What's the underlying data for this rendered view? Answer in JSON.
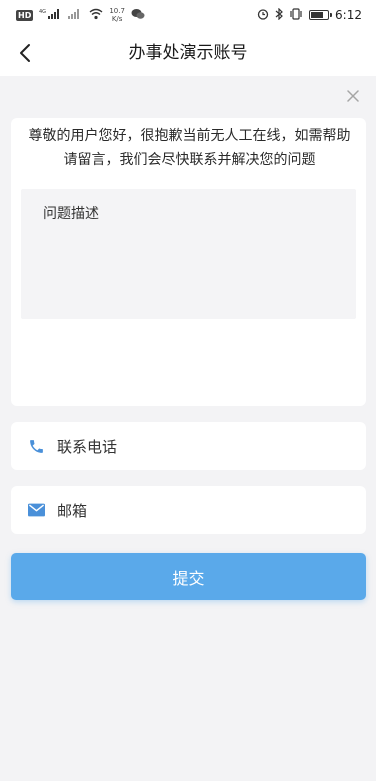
{
  "status_bar": {
    "hd_badge": "HD",
    "sim_badge": "1",
    "network": "4G",
    "speed_value": "10.7",
    "speed_unit": "K/s",
    "time": "6:12",
    "battery_level": 0.75
  },
  "nav": {
    "title": "办事处演示账号"
  },
  "notice": "尊敬的用户您好，很抱歉当前无人工在线，如需帮助请留言，我们会尽快联系并解决您的问题",
  "form": {
    "description_placeholder": "问题描述",
    "phone_label": "联系电话",
    "email_label": "邮箱",
    "submit_label": "提交"
  },
  "colors": {
    "accent": "#5aa9ea",
    "icon_blue": "#4a90d9",
    "page_bg": "#f3f3f5"
  },
  "icons": {
    "back": "chevron-left-icon",
    "close": "close-icon",
    "phone": "phone-icon",
    "email": "mail-icon"
  }
}
